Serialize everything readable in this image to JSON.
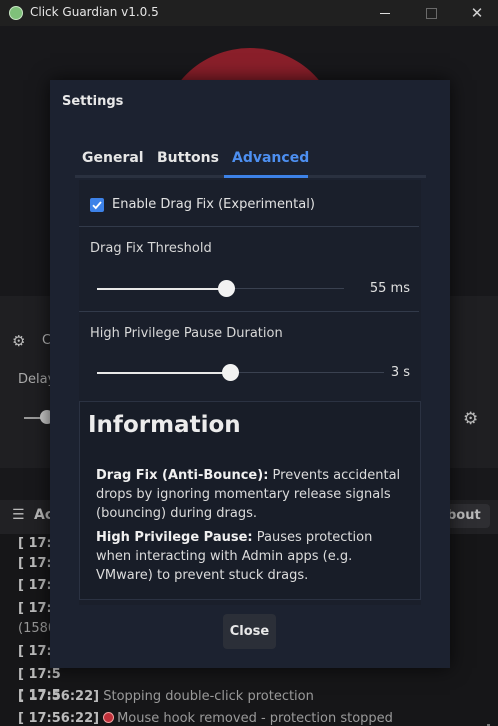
{
  "window": {
    "title": "Click Guardian v1.0.5",
    "minimize_icon": "minimize-icon",
    "maximize_icon": "maximize-icon",
    "close_symbol": "✕"
  },
  "background": {
    "gear_symbol": "⚙",
    "config_partial": "C",
    "delay_partial": "Delay",
    "log_partial": "Ac",
    "about_partial": "bout",
    "log_lines": [
      {
        "time": "[ 17:5",
        "text": ""
      },
      {
        "time": "[ 17:5",
        "text": ""
      },
      {
        "time": "[ 17:5",
        "text": ""
      },
      {
        "time": "[ 17:5",
        "text": ""
      },
      {
        "time": "",
        "text": "(1580"
      },
      {
        "time": "[ 17:5",
        "text": ""
      },
      {
        "time": "[ 17:5",
        "text": ""
      },
      {
        "time": "[ 17:5",
        "text": ""
      },
      {
        "time": "[ 17:56:22]",
        "text": "Stopping double-click protection"
      },
      {
        "time": "[ 17:56:22]",
        "text": "Mouse hook removed - protection stopped"
      }
    ]
  },
  "settings": {
    "title": "Settings",
    "tabs": [
      {
        "label": "General",
        "active": false
      },
      {
        "label": "Buttons",
        "active": false
      },
      {
        "label": "Advanced",
        "active": true
      }
    ],
    "drag_fix_enabled": true,
    "drag_fix_label": "Enable Drag Fix (Experimental)",
    "threshold": {
      "label": "Drag Fix Threshold",
      "value": "55 ms",
      "level_fraction": 0.52
    },
    "pause": {
      "label": "High Privilege Pause Duration",
      "value": "3 s",
      "level_fraction": 0.54
    },
    "info": {
      "title": "Information",
      "p1_bold": "Drag Fix (Anti-Bounce):",
      "p1_text": " Prevents accidental drops by ignoring momentary release signals (bouncing) during drags.",
      "p2_bold": "High Privilege Pause:",
      "p2_text": " Pauses protection when interacting with Admin apps (e.g. VMware) to prevent stuck drags."
    },
    "close_label": "Close"
  },
  "colors": {
    "accent": "#3d82e8",
    "danger": "#c0303a"
  }
}
